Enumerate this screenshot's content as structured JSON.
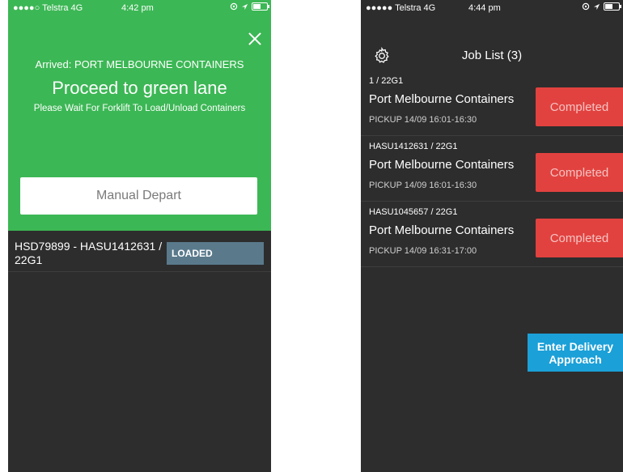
{
  "left_screen": {
    "status_bar": {
      "carrier": "●●●●○ Telstra 4G",
      "time": "4:42 pm"
    },
    "arrived_text": "Arrived: PORT MELBOURNE CONTAINERS",
    "instruction": "Proceed to green lane",
    "wait_text": "Please Wait For Forklift To Load/Unload Containers",
    "depart_button": "Manual Depart",
    "container": {
      "reference": "HSD79899 - HASU1412631 / 22G1",
      "status": "LOADED"
    },
    "colors": {
      "panel": "#3cb755",
      "badge": "#5a7a8c"
    }
  },
  "right_screen": {
    "status_bar": {
      "carrier": "●●●●● Telstra 4G",
      "time": "4:44 pm"
    },
    "title": "Job List (3)",
    "jobs": [
      {
        "id": "1 / 22G1",
        "name": "Port Melbourne Containers",
        "schedule": "PICKUP 14/09 16:01-16:30",
        "status": "Completed"
      },
      {
        "id": "HASU1412631 / 22G1",
        "name": "Port Melbourne Containers",
        "schedule": "PICKUP 14/09 16:01-16:30",
        "status": "Completed"
      },
      {
        "id": "HASU1045657 / 22G1",
        "name": "Port Melbourne Containers",
        "schedule": "PICKUP 14/09 16:31-17:00",
        "status": "Completed"
      }
    ],
    "action_button": {
      "line1": "Enter Delivery",
      "line2": "Approach"
    },
    "colors": {
      "completed": "#e2423f",
      "action": "#1ba0d8"
    }
  }
}
